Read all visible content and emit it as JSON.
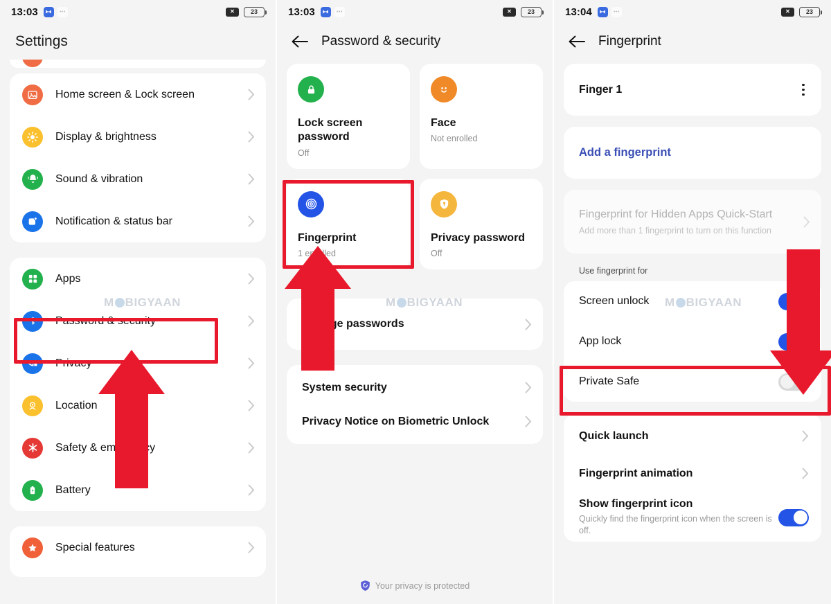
{
  "panels": [
    {
      "status": {
        "time": "13:03",
        "battery": "23",
        "mute_icon": "mute-icon",
        "app_icon": "messaging-icon",
        "dots_icon": "more-icon"
      },
      "title": "Settings",
      "groups": [
        {
          "items": [
            {
              "label": "Home screen & Lock screen",
              "icon": "image-icon",
              "color": "#ef6c45"
            },
            {
              "label": "Display & brightness",
              "icon": "sun-icon",
              "color": "#fbc02d"
            },
            {
              "label": "Sound & vibration",
              "icon": "bell-icon",
              "color": "#22b14c"
            },
            {
              "label": "Notification & status bar",
              "icon": "notification-icon",
              "color": "#1a73e8"
            }
          ]
        },
        {
          "items": [
            {
              "label": "Apps",
              "icon": "grid-icon",
              "color": "#22b14c"
            },
            {
              "label": "Password & security",
              "icon": "key-icon",
              "color": "#1a73e8"
            },
            {
              "label": "Privacy",
              "icon": "privacy-eye-icon",
              "color": "#1a73e8"
            },
            {
              "label": "Location",
              "icon": "location-icon",
              "color": "#fbc02d"
            },
            {
              "label": "Safety & emergency",
              "icon": "emergency-icon",
              "color": "#e53935"
            },
            {
              "label": "Battery",
              "icon": "battery-icon",
              "color": "#22b14c"
            }
          ]
        },
        {
          "items": [
            {
              "label": "Special features",
              "icon": "star-icon",
              "color": "#f0613a"
            }
          ]
        }
      ],
      "watermark": "MOBIGYAAN"
    },
    {
      "status": {
        "time": "13:03",
        "battery": "23",
        "mute_icon": "mute-icon",
        "app_icon": "messaging-icon",
        "dots_icon": "more-icon"
      },
      "title": "Password & security",
      "back_icon": "back-arrow-icon",
      "tiles": [
        {
          "title": "Lock screen password",
          "sub": "Off",
          "icon": "lock-icon",
          "color": "#22b14c"
        },
        {
          "title": "Face",
          "sub": "Not enrolled",
          "icon": "face-icon",
          "color": "#f08a28"
        },
        {
          "title": "Fingerprint",
          "sub": "1 enrolled",
          "icon": "fingerprint-icon",
          "color": "#2354e6"
        },
        {
          "title": "Privacy password",
          "sub": "Off",
          "icon": "shield-key-icon",
          "color": "#f5b63d"
        }
      ],
      "rows_group_a": [
        {
          "label": "Manage passwords"
        }
      ],
      "rows_group_b": [
        {
          "label": "System security"
        },
        {
          "label": "Privacy Notice on Biometric Unlock"
        }
      ],
      "footer": {
        "text": "Your privacy is protected",
        "icon": "shield-icon"
      },
      "watermark": "MOBIGYAAN"
    },
    {
      "status": {
        "time": "13:04",
        "battery": "23",
        "mute_icon": "mute-icon",
        "app_icon": "messaging-icon",
        "dots_icon": "more-icon"
      },
      "title": "Fingerprint",
      "back_icon": "back-arrow-icon",
      "finger": {
        "label": "Finger 1",
        "menu_icon": "kebab-menu-icon"
      },
      "add_link": "Add a fingerprint",
      "hidden_apps": {
        "title": "Fingerprint for Hidden Apps Quick-Start",
        "sub": "Add more than 1 fingerprint to turn on this function"
      },
      "use_for_label": "Use fingerprint for",
      "toggles": [
        {
          "label": "Screen unlock",
          "state": "on"
        },
        {
          "label": "App lock",
          "state": "on"
        },
        {
          "label": "Private Safe",
          "state": "off"
        }
      ],
      "more_rows": [
        {
          "label": "Quick launch",
          "type": "chevron"
        },
        {
          "label": "Fingerprint animation",
          "type": "chevron"
        }
      ],
      "show_icon": {
        "label": "Show fingerprint icon",
        "sub": "Quickly find the fingerprint icon when the screen is off.",
        "state": "on"
      },
      "watermark": "MOBIGYAAN"
    }
  ],
  "annotations": {
    "highlight_color": "#e8192c",
    "arrow_color": "#e8192c",
    "boxes": [
      {
        "name": "password-security-highlight"
      },
      {
        "name": "fingerprint-tile-highlight"
      },
      {
        "name": "app-lock-highlight"
      }
    ]
  }
}
